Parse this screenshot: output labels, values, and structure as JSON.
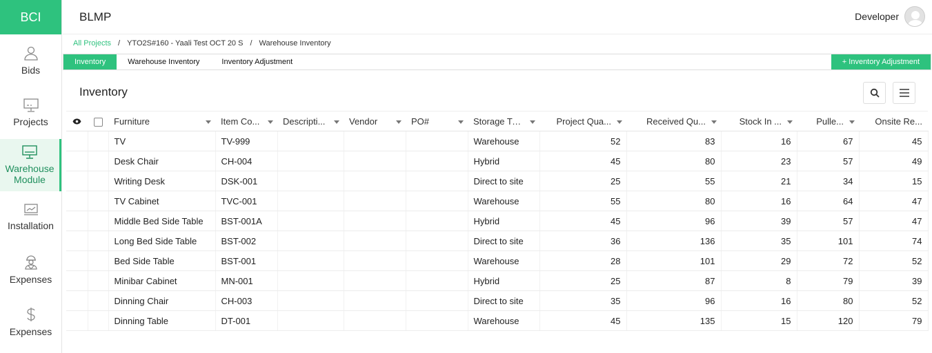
{
  "sidebar": {
    "logo": "BCI",
    "items": [
      {
        "label": "Bids",
        "icon": "user-icon"
      },
      {
        "label": "Projects",
        "icon": "monitor-icon"
      },
      {
        "label": "Warehouse Module",
        "icon": "warehouse-monitor-icon",
        "active": true
      },
      {
        "label": "Installation",
        "icon": "chart-monitor-icon"
      },
      {
        "label": "Expenses",
        "icon": "worker-icon"
      },
      {
        "label": "Expenses",
        "icon": "dollar-icon"
      }
    ]
  },
  "header": {
    "title": "BLMP",
    "user": "Developer"
  },
  "breadcrumb": {
    "root": "All Projects",
    "project": "YTO2S#160 - Yaali Test OCT 20 S",
    "current": "Warehouse Inventory",
    "separator": "/"
  },
  "tabs": {
    "items": [
      "Inventory",
      "Warehouse Inventory",
      "Inventory Adjustment"
    ],
    "active": 0,
    "action": "+ Inventory Adjustment"
  },
  "panel": {
    "title": "Inventory"
  },
  "table": {
    "headers": [
      "Furniture",
      "Item Co...",
      "Descripti...",
      "Vendor",
      "PO#",
      "Storage Ty...",
      "Project Qua...",
      "Received Qu...",
      "Stock In ...",
      "Pulle...",
      "Onsite Re..."
    ],
    "rows": [
      [
        "TV",
        "TV-999",
        "",
        "",
        "",
        "Warehouse",
        "52",
        "83",
        "16",
        "67",
        "45"
      ],
      [
        "Desk Chair",
        "CH-004",
        "",
        "",
        "",
        "Hybrid",
        "45",
        "80",
        "23",
        "57",
        "49"
      ],
      [
        "Writing Desk",
        "DSK-001",
        "",
        "",
        "",
        "Direct to site",
        "25",
        "55",
        "21",
        "34",
        "15"
      ],
      [
        "TV Cabinet",
        "TVC-001",
        "",
        "",
        "",
        "Warehouse",
        "55",
        "80",
        "16",
        "64",
        "47"
      ],
      [
        "Middle Bed Side Table",
        "BST-001A",
        "",
        "",
        "",
        "Hybrid",
        "45",
        "96",
        "39",
        "57",
        "47"
      ],
      [
        "Long Bed Side Table",
        "BST-002",
        "",
        "",
        "",
        "Direct to site",
        "36",
        "136",
        "35",
        "101",
        "74"
      ],
      [
        "Bed Side Table",
        "BST-001",
        "",
        "",
        "",
        "Warehouse",
        "28",
        "101",
        "29",
        "72",
        "52"
      ],
      [
        "Minibar Cabinet",
        "MN-001",
        "",
        "",
        "",
        "Hybrid",
        "25",
        "87",
        "8",
        "79",
        "39"
      ],
      [
        "Dinning Chair",
        "CH-003",
        "",
        "",
        "",
        "Direct to site",
        "35",
        "96",
        "16",
        "80",
        "52"
      ],
      [
        "Dinning Table",
        "DT-001",
        "",
        "",
        "",
        "Warehouse",
        "45",
        "135",
        "15",
        "120",
        "79"
      ]
    ]
  },
  "colors": {
    "accent": "#2ec27e"
  }
}
